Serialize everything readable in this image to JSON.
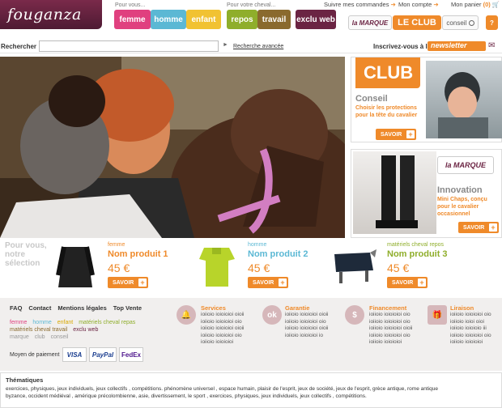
{
  "logo": {
    "text": "fouganza"
  },
  "header": {
    "pour_vous": "Pour vous...",
    "pour_cheval": "Pour votre cheval...",
    "btn_femme": "femme",
    "btn_homme": "homme",
    "btn_enfant": "enfant",
    "btn_repos": "repos",
    "btn_travail": "travail",
    "btn_exclu": "exclu web",
    "suivre": "Suivre mes commandes",
    "mon_compte": "Mon compte",
    "panier": "Mon panier",
    "panier_count": "(0)",
    "marque": "la MARQUE",
    "club": "LE CLUB",
    "conseil": "conseil",
    "help": "?"
  },
  "search": {
    "label": "Rechercher",
    "value": "",
    "advanced": "Recherche avancée",
    "newsletter_prefix": "Inscrivez-vous à la",
    "newsletter": "newsletter"
  },
  "promos": [
    {
      "badge": "CLUB",
      "title": "Conseil",
      "text": "Choisir les protections pour la tête du cavalier",
      "cta": "SAVOIR"
    },
    {
      "badge": "la MARQUE",
      "title": "Innovation",
      "text": "Mini Chaps, conçu pour le cavalier occasionnel",
      "cta": "SAVOIR"
    }
  ],
  "products": {
    "heading": "Pour vous, notre sélection",
    "items": [
      {
        "cat": "femme",
        "name": "Nom produit 1",
        "price": "45 €",
        "cta": "SAVOIR",
        "color": "#ef8a2a"
      },
      {
        "cat": "homme",
        "name": "Nom produit 2",
        "price": "45 €",
        "cta": "SAVOIR",
        "color": "#5bb8d4"
      },
      {
        "cat": "matériels cheval repos",
        "name": "Nom produit 3",
        "price": "45 €",
        "cta": "SAVOIR",
        "color": "#8fae2b"
      }
    ]
  },
  "footer": {
    "links1": [
      "FAQ",
      "Contact",
      "Mentions légales",
      "Top Vente"
    ],
    "links2": [
      "femme",
      "homme",
      "enfant",
      "matériels cheval repas"
    ],
    "links3": [
      "matériels cheval travail",
      "exclu web"
    ],
    "links4": [
      "marque",
      "club",
      "conseil"
    ],
    "payment_label": "Moyen de paiement",
    "payments": [
      "VISA",
      "PayPal",
      "FedEx"
    ],
    "services": [
      {
        "title": "Services",
        "icon": "bell-icon",
        "lines": [
          "ioiioio ioioioioi oioii",
          "ioiioio ioioioioi oio",
          "ioiioio ioioioioi oioii",
          "ioiioio ioioioioi oio",
          "ioiioio ioioioioi"
        ]
      },
      {
        "title": "Garantie",
        "icon": "ok-icon",
        "lines": [
          "ioiioio ioioioioi oioii",
          "ioiioio ioioioioi oio",
          "ioiioio ioioioioi oioii",
          "ioiioio ioioioioi io"
        ]
      },
      {
        "title": "Financement",
        "icon": "piggy-bank-icon",
        "lines": [
          "ioiioio ioioioioi oio",
          "ioiioio ioioioioi oio",
          "ioiioio ioioioioi oioii",
          "ioiioio ioioioioi oio",
          "ioiioio ioioioioi"
        ]
      },
      {
        "title": "Liraison",
        "icon": "gift-icon",
        "lines": [
          "ioiioio ioioioioi oio",
          "ioiioio ioioi oioi",
          "ioiioio ioioioio iii",
          "ioiioio ioioioioi oio",
          "ioiioio ioioioioi"
        ]
      }
    ]
  },
  "thematiques": {
    "title": "Thématiques",
    "line1": "exercices, physiques, jeux individuels, jeux collectifs , compétitions. phénomène  universel , espace humain, plaisir de l'esprit, jeux de société, jeux de l'esprit, grèce antique, rome antique",
    "line2": "byzance, occident médiéval , amérique précolombienne, asie, divertissement, le sport , exercices, physiques, jeux individuels, jeux collectifs , compétitions."
  },
  "colors": {
    "brand": "#6b2443",
    "orange": "#ef8a2a",
    "femme": "#e0407f",
    "homme": "#5bb8d4",
    "enfant": "#f1c232",
    "repos": "#8fae2b",
    "travail": "#8a6a2e",
    "exclu": "#6b2443"
  }
}
